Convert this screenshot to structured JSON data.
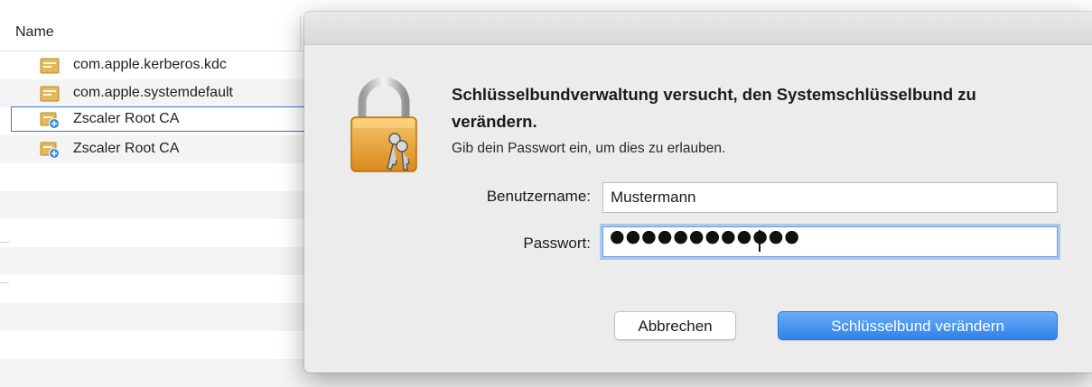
{
  "list": {
    "column_header": "Name",
    "items": [
      {
        "label": "com.apple.kerberos.kdc",
        "icon": "keychain-item-icon"
      },
      {
        "label": "com.apple.systemdefault",
        "icon": "keychain-item-icon"
      },
      {
        "label": "Zscaler Root CA",
        "icon": "certificate-icon",
        "selected": true
      },
      {
        "label": "Zscaler Root CA",
        "icon": "certificate-icon"
      }
    ]
  },
  "dialog": {
    "title": "Schlüsselbundverwaltung versucht, den Systemschlüsselbund zu verändern.",
    "subtitle": "Gib dein Passwort ein, um dies zu erlauben.",
    "username_label": "Benutzername:",
    "username_value": "Mustermann",
    "password_label": "Passwort:",
    "password_mask": "●●●●●●●●●●●●",
    "cancel_label": "Abbrechen",
    "confirm_label": "Schlüsselbund verändern",
    "icon": "lock-icon"
  },
  "colors": {
    "accent": "#3a78c9",
    "default_button": "#3d8bf0"
  }
}
